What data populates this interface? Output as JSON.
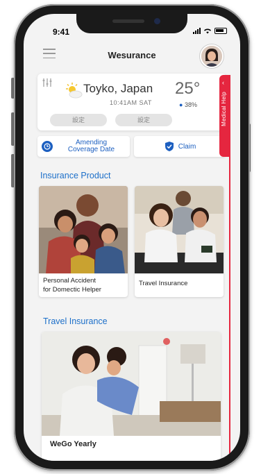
{
  "status": {
    "time": "9:41"
  },
  "app": {
    "title": "Wesurance"
  },
  "weather": {
    "city": "Toyko, Japan",
    "time_day": "10:41AM  SAT",
    "temperature": "25°",
    "humidity": "38%",
    "button_1": "設定",
    "button_2": "設定"
  },
  "actions": {
    "amend_label": "Amending Coverage Date",
    "claim_label": "Claim"
  },
  "side_tab": {
    "label": "Medical Help"
  },
  "sections": {
    "insurance_product": "Insurance Product",
    "travel_insurance": "Travel Insurance"
  },
  "products": [
    {
      "line1": "Personal Accident",
      "line2": "for Domectic Helper"
    },
    {
      "line1": "Travel Insurance",
      "line2": ""
    }
  ],
  "featured": {
    "title": "WeGo Yearly"
  },
  "colors": {
    "accent": "#1c6fc9",
    "alert": "#e5263f"
  }
}
